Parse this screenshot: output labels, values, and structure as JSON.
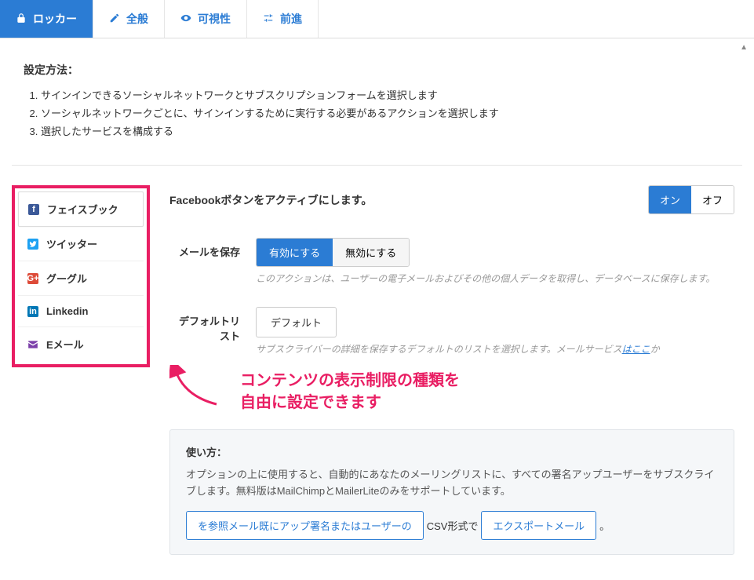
{
  "tabs": {
    "locker": "ロッカー",
    "general": "全般",
    "visibility": "可視性",
    "advanced": "前進"
  },
  "setup": {
    "heading": "設定方法：",
    "steps": [
      "サインインできるソーシャルネットワークとサブスクリプションフォームを選択します",
      "ソーシャルネットワークごとに、サインインするために実行する必要があるアクションを選択します",
      "選択したサービスを構成する"
    ]
  },
  "sidebar": {
    "items": [
      {
        "label": "フェイスブック"
      },
      {
        "label": "ツイッター"
      },
      {
        "label": "グーグル"
      },
      {
        "label": "Linkedin"
      },
      {
        "label": "Eメール"
      }
    ]
  },
  "facebook": {
    "activate_label": "Facebookボタンをアクティブにします。",
    "on": "オン",
    "off": "オフ"
  },
  "save_email": {
    "label": "メールを保存",
    "enable": "有効にする",
    "disable": "無効にする",
    "help": "このアクションは、ユーザーの電子メールおよびその他の個人データを取得し、データベースに保存します。"
  },
  "default_list": {
    "label": "デフォルトリスト",
    "value": "デフォルト",
    "help_pre": "サブスクライバーの詳細を保存するデフォルトのリストを選択します。メールサービス",
    "help_link": "はここ",
    "help_post": "か"
  },
  "annotation": {
    "line1": "コンテンツの表示制限の種類を",
    "line2": "自由に設定できます"
  },
  "usage": {
    "heading": "使い方：",
    "body": "オプションの上に使用すると、自動的にあなたのメーリングリストに、すべての署名アップユーザーをサブスクライブします。無料版はMailChimpとMailerLiteのみをサポートしています。",
    "link1": "を参照メール既にアップ署名またはユーザーの",
    "mid": " CSV形式で ",
    "link2": "エクスポートメール",
    "period": "。"
  }
}
